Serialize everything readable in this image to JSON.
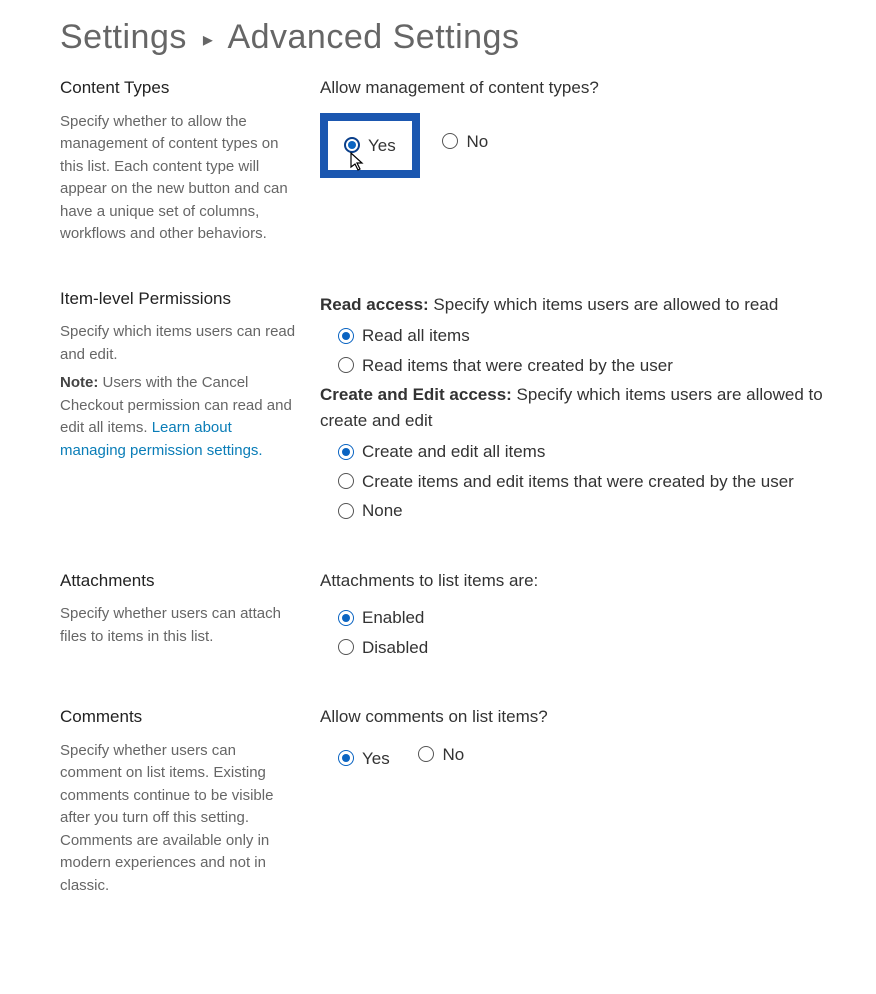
{
  "breadcrumb": {
    "parent": "Settings",
    "current": "Advanced Settings"
  },
  "content_types": {
    "title": "Content Types",
    "desc": "Specify whether to allow the management of content types on this list. Each content type will appear on the new button and can have a unique set of columns, workflows and other behaviors.",
    "question": "Allow management of content types?",
    "options": {
      "yes": "Yes",
      "no": "No"
    },
    "selected": "yes"
  },
  "item_perms": {
    "title": "Item-level Permissions",
    "desc": "Specify which items users can read and edit.",
    "note_label": "Note:",
    "note_text": " Users with the Cancel Checkout permission can read and edit all items. ",
    "link_text": "Learn about managing permission settings.",
    "read_label": "Read access:",
    "read_desc": "  Specify which items users are allowed to read",
    "read_options": {
      "all": "Read all items",
      "own": "Read items that were created by the user"
    },
    "read_selected": "all",
    "edit_label": "Create and Edit access:",
    "edit_desc": "  Specify which items users are allowed to create and edit",
    "edit_options": {
      "all": "Create and edit all items",
      "own": "Create items and edit items that were created by the user",
      "none": "None"
    },
    "edit_selected": "all"
  },
  "attachments": {
    "title": "Attachments",
    "desc": "Specify whether users can attach files to items in this list.",
    "question": "Attachments to list items are:",
    "options": {
      "enabled": "Enabled",
      "disabled": "Disabled"
    },
    "selected": "enabled"
  },
  "comments": {
    "title": "Comments",
    "desc": "Specify whether users can comment on list items. Existing comments continue to be visible after you turn off this setting. Comments are available only in modern experiences and not in classic.",
    "question": "Allow comments on list items?",
    "options": {
      "yes": "Yes",
      "no": "No"
    },
    "selected": "yes"
  }
}
